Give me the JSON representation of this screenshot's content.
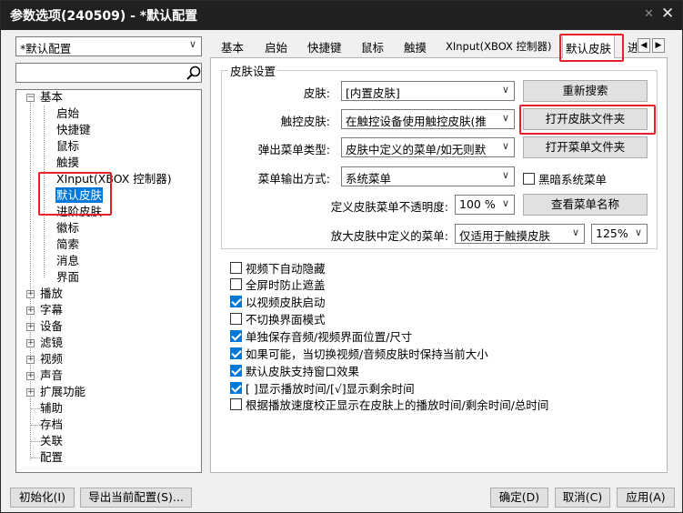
{
  "window": {
    "title": "参数选项(240509) - *默认配置"
  },
  "title_icons": {
    "pin": "pin-icon",
    "close": "close-icon"
  },
  "accent_colors": {
    "selection": "#0078d7",
    "highlight_box": "#e8202a",
    "titlebar": "#202020"
  },
  "left": {
    "profile_select": "*默认配置",
    "search_placeholder": "",
    "tree": {
      "basic": "基本",
      "basic_children": [
        "启始",
        "快捷键",
        "鼠标",
        "触摸",
        "XInput(XBOX 控制器)",
        "默认皮肤",
        "进阶皮肤",
        "徽标",
        "简索",
        "消息",
        "界面"
      ],
      "selected_child": "默认皮肤",
      "expandable": [
        "播放",
        "字幕",
        "设备",
        "滤镜",
        "视频",
        "声音",
        "扩展功能"
      ],
      "leaves": [
        "辅助",
        "存档",
        "关联",
        "配置"
      ]
    }
  },
  "tabs": [
    "基本",
    "启始",
    "快捷键",
    "鼠标",
    "触摸",
    "XInput(XBOX 控制器)",
    "默认皮肤",
    "进"
  ],
  "active_tab": "默认皮肤",
  "group_title": "皮肤设置",
  "form": {
    "skin_label": "皮肤:",
    "skin_value": "[内置皮肤]",
    "research_btn": "重新搜索",
    "touch_label": "触控皮肤:",
    "touch_value": "在触控设备使用触控皮肤(推",
    "open_skin_folder_btn": "打开皮肤文件夹",
    "popup_label": "弹出菜单类型:",
    "popup_value": "皮肤中定义的菜单/如无则默",
    "open_menu_folder_btn": "打开菜单文件夹",
    "menu_output_label": "菜单输出方式:",
    "menu_output_value": "系统菜单",
    "dark_menu_label": "黑暗系统菜单",
    "dark_menu_checked": false,
    "opacity_label": "定义皮肤菜单不透明度:",
    "opacity_value": "100 %",
    "view_menu_btn": "查看菜单名称",
    "enlarge_label": "放大皮肤中定义的菜单:",
    "enlarge_value": "仅适用于触摸皮肤",
    "scale_value": "125%"
  },
  "options": [
    {
      "label": "视频下自动隐藏",
      "checked": false
    },
    {
      "label": "全屏时防止遮盖",
      "checked": false
    },
    {
      "label": "以视频皮肤启动",
      "checked": true
    },
    {
      "label": "不切换界面模式",
      "checked": false
    },
    {
      "label": "单独保存音频/视频界面位置/尺寸",
      "checked": true
    },
    {
      "label": "如果可能，当切换视频/音频皮肤时保持当前大小",
      "checked": true
    },
    {
      "label": "默认皮肤支持窗口效果",
      "checked": true
    },
    {
      "label": "[ ]显示播放时间/[√]显示剩余时间",
      "checked": true
    },
    {
      "label": "根据播放速度校正显示在皮肤上的播放时间/剩余时间/总时间",
      "checked": false
    }
  ],
  "bottom": {
    "init_btn": "初始化(I)",
    "export_btn": "导出当前配置(S)...",
    "ok_btn": "确定(D)",
    "cancel_btn": "取消(C)",
    "apply_btn": "应用(A)"
  }
}
